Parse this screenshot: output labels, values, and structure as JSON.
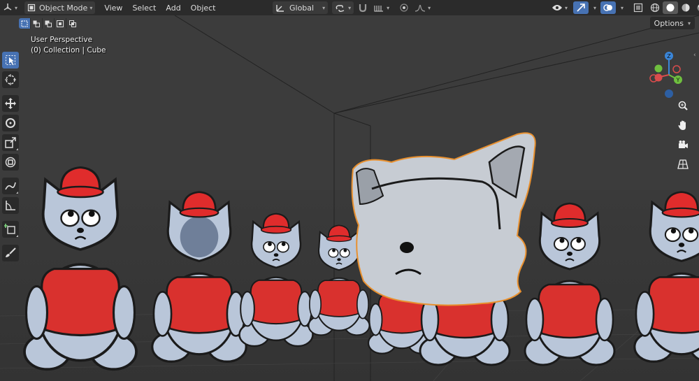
{
  "header": {
    "editor_type_icon": "view3d-icon",
    "mode_label": "Object Mode",
    "menus": [
      "View",
      "Select",
      "Add",
      "Object"
    ],
    "transform_orientation_label": "Global",
    "icons": {
      "pivot": "pivot-icon",
      "snap": "magnet-icon",
      "snap_target": "snap-increment-icon",
      "proportional": "proportional-edit-icon",
      "falloff": "falloff-curve-icon",
      "visibility": "eye-icon",
      "gizmo": "gizmo-icon",
      "overlay": "overlay-icon",
      "xray": "xray-icon",
      "shading": [
        "wireframe-icon",
        "solid-icon",
        "material-preview-icon",
        "rendered-icon"
      ]
    },
    "accent": "#4772b3"
  },
  "subheader": {
    "selection_modes": [
      "select-new-icon",
      "select-extend-icon",
      "select-subtract-icon",
      "select-invert-icon",
      "select-intersect-icon"
    ],
    "options_label": "Options"
  },
  "viewport": {
    "view_name": "User Perspective",
    "context_info": "(0) Collection | Cube"
  },
  "toolbar": {
    "tools": [
      {
        "name": "select-box-icon",
        "active": true
      },
      {
        "name": "cursor-icon"
      },
      {
        "name": "move-icon"
      },
      {
        "name": "rotate-icon"
      },
      {
        "name": "scale-icon"
      },
      {
        "name": "transform-icon"
      },
      {
        "name": "annotate-icon"
      },
      {
        "name": "measure-icon"
      },
      {
        "name": "add-cube-icon"
      },
      {
        "name": "paint-brush-icon"
      }
    ]
  },
  "navigation_gizmo": {
    "axes": [
      "Z",
      "Y",
      "X"
    ],
    "axis_colors": {
      "x": "#d94c4c",
      "y": "#6fbf3f",
      "z": "#3a86d9"
    }
  },
  "nav_buttons": [
    "zoom-icon",
    "hand-pan-icon",
    "camera-icon",
    "grid-ortho-icon"
  ],
  "characters": {
    "body_color": "#b9c6d9",
    "vest_color": "#d9312e",
    "hat_color": "#e02c2c",
    "outline_color": "#1b1b1b",
    "selected_outline": "#e8902f"
  }
}
